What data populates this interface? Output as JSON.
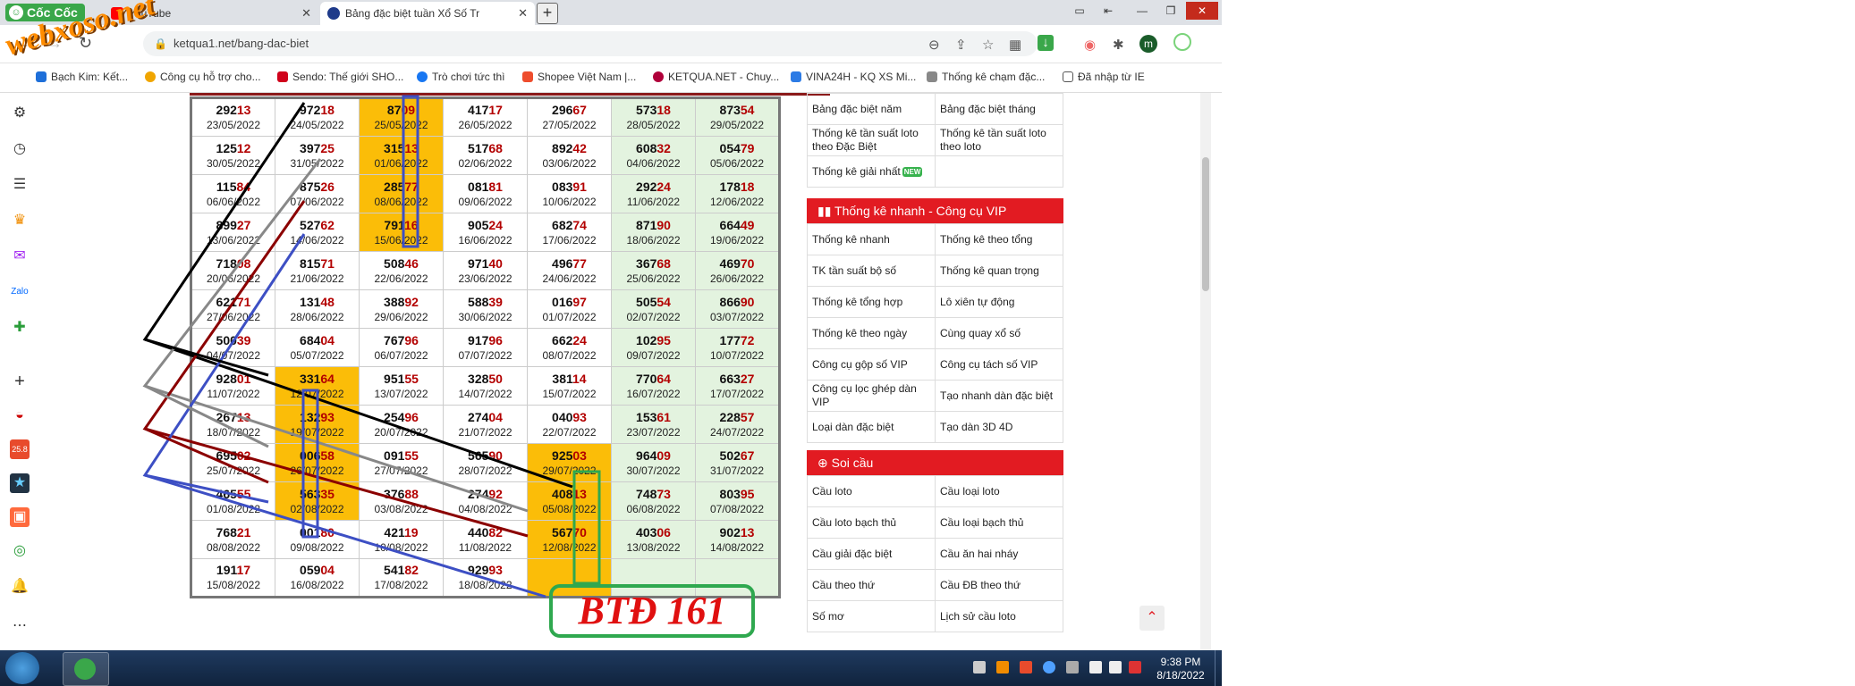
{
  "browser": {
    "brand": "Cốc Cốc",
    "tabs": [
      {
        "title": "YouTube"
      },
      {
        "title": "Bảng đặc biệt tuần Xổ Số Tr"
      }
    ],
    "url": "ketqua1.net/bang-dac-biet",
    "profile_initial": "m"
  },
  "bookmarks": [
    {
      "label": "Bạch Kim: Kết...",
      "color": "#1e6fd9"
    },
    {
      "label": "Công cụ hỗ trợ cho...",
      "color": "#f0a500"
    },
    {
      "label": "Sendo: Thế giới SHO...",
      "color": "#d0021b"
    },
    {
      "label": "Trò chơi tức thì",
      "color": "#1877f2"
    },
    {
      "label": "Shopee Việt Nam |...",
      "color": "#ee4d2d"
    },
    {
      "label": "KETQUA.NET - Chuy...",
      "color": "#b0003a"
    },
    {
      "label": "VINA24H - KQ XS Mi...",
      "color": "#2c7be5"
    },
    {
      "label": "Thống kê chạm đặc...",
      "color": "#888888"
    },
    {
      "label": "Đã nhập từ IE",
      "color": "#555555"
    }
  ],
  "grid": [
    [
      {
        "h": "292",
        "t": "13",
        "d": "23/05/2022"
      },
      {
        "h": "972",
        "t": "18",
        "d": "24/05/2022"
      },
      {
        "h": "87",
        "t": "09",
        "d": "25/05/2022",
        "hl": true
      },
      {
        "h": "417",
        "t": "17",
        "d": "26/05/2022"
      },
      {
        "h": "296",
        "t": "67",
        "d": "27/05/2022"
      },
      {
        "h": "573",
        "t": "18",
        "d": "28/05/2022",
        "g": true
      },
      {
        "h": "873",
        "t": "54",
        "d": "29/05/2022",
        "g": true
      }
    ],
    [
      {
        "h": "125",
        "t": "12",
        "d": "30/05/2022"
      },
      {
        "h": "397",
        "t": "25",
        "d": "31/05/2022"
      },
      {
        "h": "315",
        "t": "13",
        "d": "01/06/2022",
        "hl": true
      },
      {
        "h": "517",
        "t": "68",
        "d": "02/06/2022"
      },
      {
        "h": "892",
        "t": "42",
        "d": "03/06/2022"
      },
      {
        "h": "608",
        "t": "32",
        "d": "04/06/2022",
        "g": true
      },
      {
        "h": "054",
        "t": "79",
        "d": "05/06/2022",
        "g": true
      }
    ],
    [
      {
        "h": "115",
        "t": "84",
        "d": "06/06/2022"
      },
      {
        "h": "875",
        "t": "26",
        "d": "07/06/2022"
      },
      {
        "h": "285",
        "t": "77",
        "d": "08/06/2022",
        "hl": true
      },
      {
        "h": "081",
        "t": "81",
        "d": "09/06/2022"
      },
      {
        "h": "083",
        "t": "91",
        "d": "10/06/2022"
      },
      {
        "h": "292",
        "t": "24",
        "d": "11/06/2022",
        "g": true
      },
      {
        "h": "178",
        "t": "18",
        "d": "12/06/2022",
        "g": true
      }
    ],
    [
      {
        "h": "899",
        "t": "27",
        "d": "13/06/2022"
      },
      {
        "h": "527",
        "t": "62",
        "d": "14/06/2022"
      },
      {
        "h": "791",
        "t": "16",
        "d": "15/06/2022",
        "hl": true
      },
      {
        "h": "905",
        "t": "24",
        "d": "16/06/2022"
      },
      {
        "h": "682",
        "t": "74",
        "d": "17/06/2022"
      },
      {
        "h": "871",
        "t": "90",
        "d": "18/06/2022",
        "g": true
      },
      {
        "h": "664",
        "t": "49",
        "d": "19/06/2022",
        "g": true
      }
    ],
    [
      {
        "h": "718",
        "t": "08",
        "d": "20/06/2022"
      },
      {
        "h": "815",
        "t": "71",
        "d": "21/06/2022"
      },
      {
        "h": "508",
        "t": "46",
        "d": "22/06/2022"
      },
      {
        "h": "971",
        "t": "40",
        "d": "23/06/2022"
      },
      {
        "h": "496",
        "t": "77",
        "d": "24/06/2022"
      },
      {
        "h": "367",
        "t": "68",
        "d": "25/06/2022",
        "g": true
      },
      {
        "h": "469",
        "t": "70",
        "d": "26/06/2022",
        "g": true
      }
    ],
    [
      {
        "h": "621",
        "t": "71",
        "d": "27/06/2022"
      },
      {
        "h": "131",
        "t": "48",
        "d": "28/06/2022"
      },
      {
        "h": "388",
        "t": "92",
        "d": "29/06/2022"
      },
      {
        "h": "588",
        "t": "39",
        "d": "30/06/2022"
      },
      {
        "h": "016",
        "t": "97",
        "d": "01/07/2022"
      },
      {
        "h": "505",
        "t": "54",
        "d": "02/07/2022",
        "g": true
      },
      {
        "h": "866",
        "t": "90",
        "d": "03/07/2022",
        "g": true
      }
    ],
    [
      {
        "h": "500",
        "t": "39",
        "d": "04/07/2022"
      },
      {
        "h": "684",
        "t": "04",
        "d": "05/07/2022"
      },
      {
        "h": "767",
        "t": "96",
        "d": "06/07/2022"
      },
      {
        "h": "917",
        "t": "96",
        "d": "07/07/2022"
      },
      {
        "h": "662",
        "t": "24",
        "d": "08/07/2022"
      },
      {
        "h": "102",
        "t": "95",
        "d": "09/07/2022",
        "g": true
      },
      {
        "h": "177",
        "t": "72",
        "d": "10/07/2022",
        "g": true
      }
    ],
    [
      {
        "h": "928",
        "t": "01",
        "d": "11/07/2022"
      },
      {
        "h": "331",
        "t": "64",
        "d": "12/07/2022",
        "hl": true
      },
      {
        "h": "951",
        "t": "55",
        "d": "13/07/2022"
      },
      {
        "h": "328",
        "t": "50",
        "d": "14/07/2022"
      },
      {
        "h": "381",
        "t": "14",
        "d": "15/07/2022"
      },
      {
        "h": "770",
        "t": "64",
        "d": "16/07/2022",
        "g": true
      },
      {
        "h": "663",
        "t": "27",
        "d": "17/07/2022",
        "g": true
      }
    ],
    [
      {
        "h": "267",
        "t": "13",
        "d": "18/07/2022"
      },
      {
        "h": "132",
        "t": "93",
        "d": "19/07/2022",
        "hl": true
      },
      {
        "h": "254",
        "t": "96",
        "d": "20/07/2022"
      },
      {
        "h": "274",
        "t": "04",
        "d": "21/07/2022"
      },
      {
        "h": "040",
        "t": "93",
        "d": "22/07/2022"
      },
      {
        "h": "153",
        "t": "61",
        "d": "23/07/2022",
        "g": true
      },
      {
        "h": "228",
        "t": "57",
        "d": "24/07/2022",
        "g": true
      }
    ],
    [
      {
        "h": "695",
        "t": "02",
        "d": "25/07/2022"
      },
      {
        "h": "006",
        "t": "58",
        "d": "26/07/2022",
        "hl": true
      },
      {
        "h": "091",
        "t": "55",
        "d": "27/07/2022"
      },
      {
        "h": "565",
        "t": "90",
        "d": "28/07/2022"
      },
      {
        "h": "925",
        "t": "03",
        "d": "29/07/2022",
        "hl": true
      },
      {
        "h": "964",
        "t": "09",
        "d": "30/07/2022",
        "g": true
      },
      {
        "h": "502",
        "t": "67",
        "d": "31/07/2022",
        "g": true
      }
    ],
    [
      {
        "h": "465",
        "t": "55",
        "d": "01/08/2022"
      },
      {
        "h": "563",
        "t": "35",
        "d": "02/08/2022",
        "hl": true
      },
      {
        "h": "376",
        "t": "88",
        "d": "03/08/2022"
      },
      {
        "h": "274",
        "t": "92",
        "d": "04/08/2022"
      },
      {
        "h": "408",
        "t": "13",
        "d": "05/08/2022",
        "hl": true
      },
      {
        "h": "748",
        "t": "73",
        "d": "06/08/2022",
        "g": true
      },
      {
        "h": "803",
        "t": "95",
        "d": "07/08/2022",
        "g": true
      }
    ],
    [
      {
        "h": "768",
        "t": "21",
        "d": "08/08/2022"
      },
      {
        "h": "001",
        "t": "80",
        "d": "09/08/2022"
      },
      {
        "h": "421",
        "t": "19",
        "d": "10/08/2022"
      },
      {
        "h": "440",
        "t": "82",
        "d": "11/08/2022"
      },
      {
        "h": "567",
        "t": "70",
        "d": "12/08/2022",
        "hl": true
      },
      {
        "h": "403",
        "t": "06",
        "d": "13/08/2022",
        "g": true
      },
      {
        "h": "902",
        "t": "13",
        "d": "14/08/2022",
        "g": true
      }
    ],
    [
      {
        "h": "191",
        "t": "17",
        "d": "15/08/2022"
      },
      {
        "h": "059",
        "t": "04",
        "d": "16/08/2022"
      },
      {
        "h": "541",
        "t": "82",
        "d": "17/08/2022"
      },
      {
        "h": "929",
        "t": "93",
        "d": "18/08/2022"
      },
      {
        "h": "",
        "t": "",
        "d": "",
        "hl": true
      },
      {
        "h": "",
        "t": "",
        "d": "",
        "g": true
      },
      {
        "h": "",
        "t": "",
        "d": "",
        "g": true
      }
    ]
  ],
  "right_panel": {
    "top_rows": [
      [
        "Bảng đặc biệt năm",
        "Bảng đặc biệt tháng"
      ],
      [
        "Thống kê tần suất loto theo Đặc Biệt",
        "Thống kê tần suất loto theo loto"
      ],
      [
        "Thống kê giải nhất",
        ""
      ]
    ],
    "new_badge": "NEW",
    "quick_header": "Thống kê nhanh - Công cụ VIP",
    "quick_rows": [
      [
        "Thống kê nhanh",
        "Thống kê theo tổng"
      ],
      [
        "TK tần suất bộ số",
        "Thống kê quan trọng"
      ],
      [
        "Thống kê tổng hợp",
        "Lô xiên tự động"
      ],
      [
        "Thống kê theo ngày",
        "Cùng quay xổ số"
      ],
      [
        "Công cụ gộp số VIP",
        "Công cụ tách số VIP"
      ],
      [
        "Công cụ lọc ghép dàn VIP",
        "Tạo nhanh dàn đặc biệt"
      ],
      [
        "Loại dàn đặc biệt",
        "Tạo dàn 3D 4D"
      ]
    ],
    "soi_header": "Soi cầu",
    "soi_rows": [
      [
        "Cầu loto",
        "Cầu loại loto"
      ],
      [
        "Cầu loto bạch thủ",
        "Cầu loại bạch thủ"
      ],
      [
        "Cầu giải đặc biệt",
        "Cầu ăn hai nháy"
      ],
      [
        "Cầu theo thứ",
        "Cầu ĐB theo thứ"
      ],
      [
        "Số mơ",
        "Lịch sử cầu loto"
      ]
    ]
  },
  "overlay": {
    "btd_label": "BTĐ 161",
    "watermark": "webxoso.net"
  },
  "taskbar": {
    "time": "9:38 PM",
    "date": "8/18/2022"
  }
}
